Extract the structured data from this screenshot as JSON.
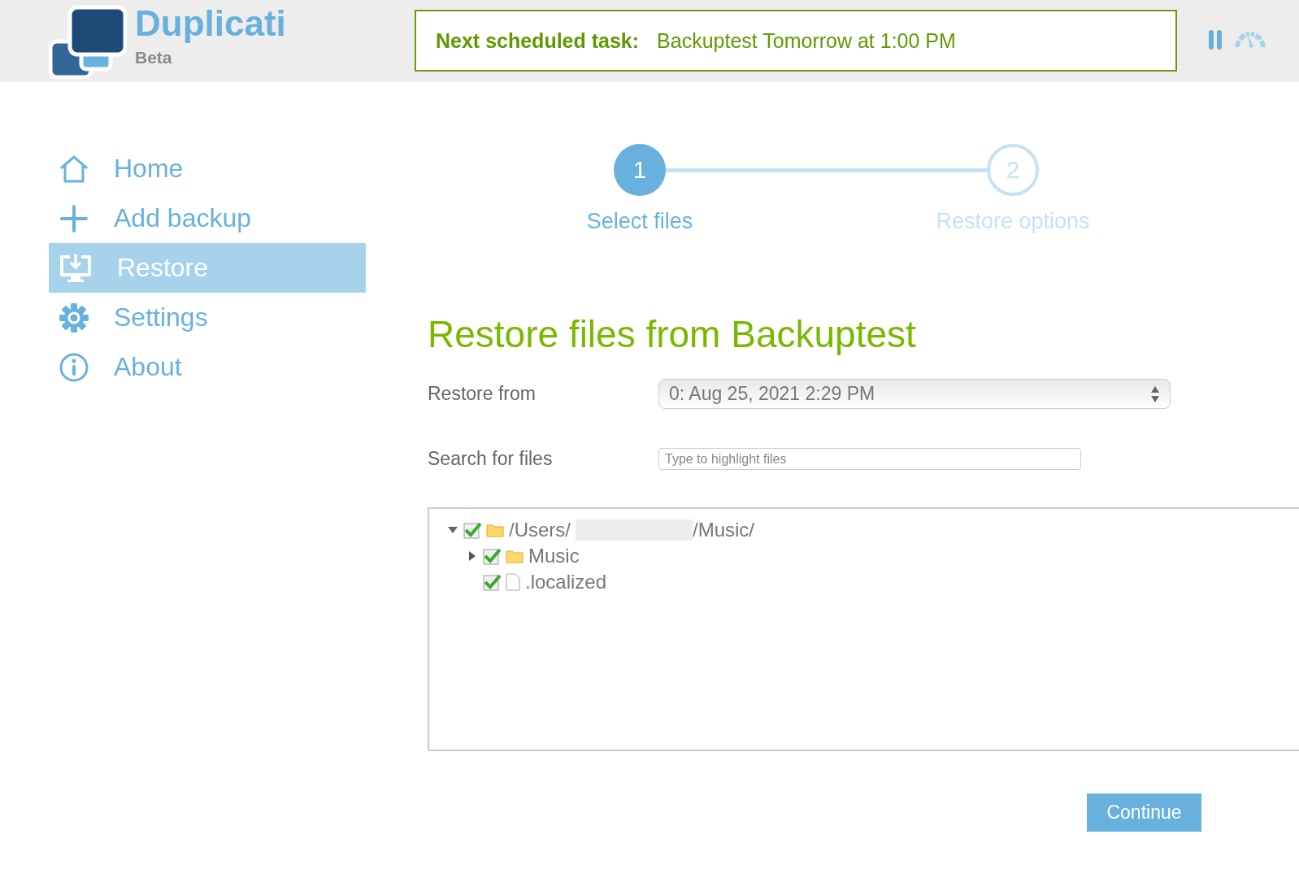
{
  "header": {
    "app_name": "Duplicati",
    "edition": "Beta",
    "schedule": {
      "label": "Next scheduled task:",
      "value": "Backuptest Tomorrow at 1:00 PM"
    }
  },
  "sidebar": {
    "items": [
      {
        "label": "Home",
        "kind": "home",
        "selected": false
      },
      {
        "label": "Add backup",
        "kind": "add",
        "selected": false
      },
      {
        "label": "Restore",
        "kind": "restore",
        "selected": true
      },
      {
        "label": "Settings",
        "kind": "settings",
        "selected": false
      },
      {
        "label": "About",
        "kind": "about",
        "selected": false
      }
    ]
  },
  "steps": [
    {
      "number": "1",
      "label": "Select files",
      "selected": true
    },
    {
      "number": "2",
      "label": "Restore options",
      "selected": false
    }
  ],
  "title": "Restore files from Backuptest",
  "form": {
    "restore_from": {
      "label": "Restore from",
      "value": "0: Aug 25, 2021 2:29 PM"
    },
    "search": {
      "label": "Search for files",
      "placeholder": "Type to highlight files"
    }
  },
  "tree": [
    {
      "kind": "folder",
      "label": "/Users/",
      "redacted": true,
      "label_after": "/Music/",
      "checked": true,
      "expanded": true,
      "children": [
        {
          "kind": "folder",
          "label": "Music",
          "checked": true,
          "expanded": false
        },
        {
          "kind": "file",
          "label": ".localized",
          "checked": true
        }
      ]
    }
  ],
  "buttons": [
    {
      "label": "Continue"
    }
  ]
}
